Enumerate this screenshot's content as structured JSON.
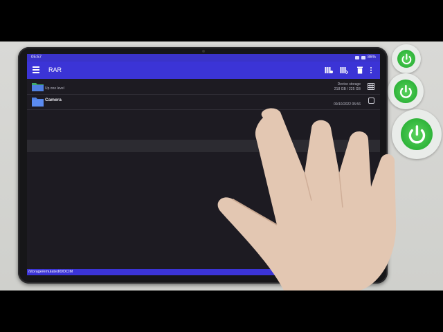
{
  "status_bar": {
    "time": "05:57",
    "battery": "86%"
  },
  "toolbar": {
    "title": "RAR"
  },
  "rows": [
    {
      "name": "",
      "subtitle": "Up one level",
      "right_top": "Device storage",
      "right_bottom": "218 GB / 225 GB"
    },
    {
      "name": "Camera",
      "subtitle": "",
      "right_top": "",
      "right_bottom": "09/10/2022 05:56"
    }
  ],
  "path_bar": {
    "path": "/storage/emulated/0/DCIM"
  },
  "colors": {
    "accent": "#3b34d6",
    "status_bar": "#3a33c9",
    "background": "#1d1b22",
    "folder": "#4f7fe0",
    "folder_up": "#3faa6a"
  }
}
